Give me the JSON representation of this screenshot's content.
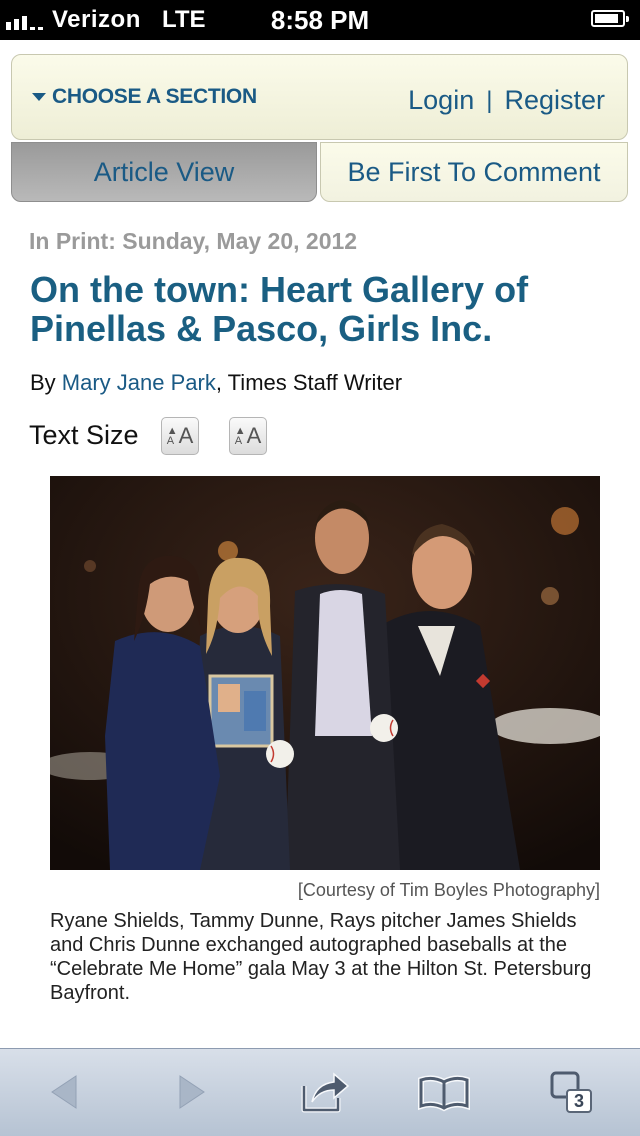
{
  "status_bar": {
    "carrier": "Verizon",
    "network": "LTE",
    "time": "8:58 PM"
  },
  "header": {
    "section_menu_label": "CHOOSE A SECTION",
    "login_label": "Login",
    "separator": "|",
    "register_label": "Register"
  },
  "tabs": {
    "article_view": "Article View",
    "comment": "Be First To Comment"
  },
  "article": {
    "print_date": "In Print: Sunday, May 20, 2012",
    "headline": "On the town: Heart Gallery of Pinellas & Pasco, Girls Inc.",
    "byline_prefix": "By ",
    "author": "Mary Jane Park",
    "byline_suffix": ", Times Staff Writer",
    "text_size_label": "Text Size",
    "photo_credit": "[Courtesy of Tim Boyles Photography]",
    "caption": "Ryane Shields, Tammy Dunne, Rays pitcher James Shields and Chris Dunne exchanged autographed baseballs at the “Celebrate Me Home” gala May 3 at the Hilton St. Petersburg Bayfront."
  },
  "toolbar": {
    "tab_count": "3"
  },
  "colors": {
    "link_blue": "#1a5a85",
    "headline_blue": "#1a5f82",
    "header_cream": "#fbfbea",
    "active_tab_gray": "#a8a8a8",
    "toolbar_blue": "#c4cfdc"
  }
}
